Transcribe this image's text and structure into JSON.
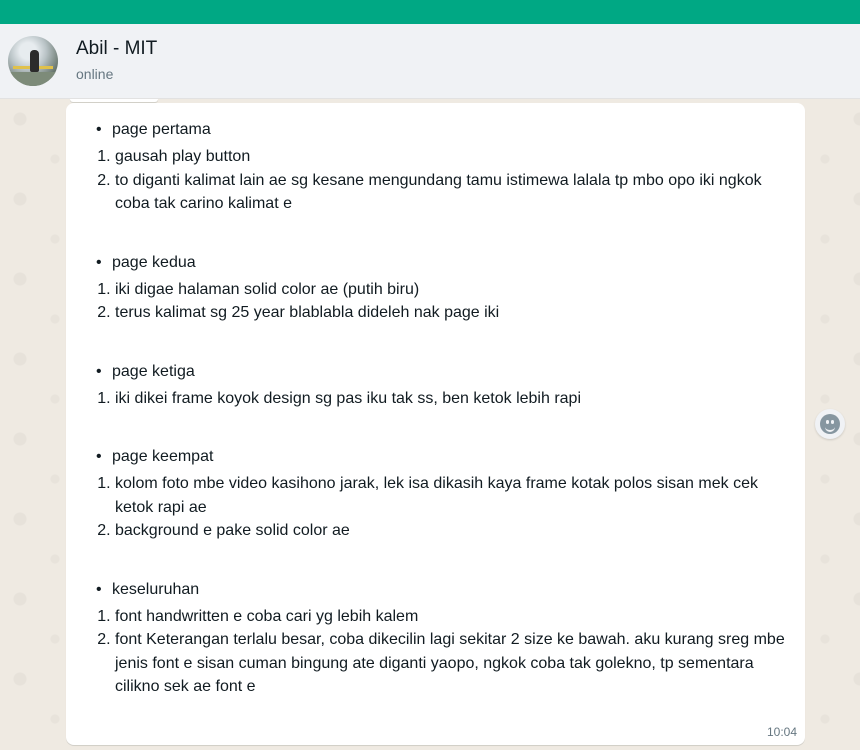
{
  "header": {
    "contact_name": "Abil - MIT",
    "status": "online"
  },
  "message": {
    "time": "10:04",
    "bullet": "•",
    "sections": [
      {
        "title": "page pertama",
        "items": [
          "gausah play button",
          "to diganti kalimat lain ae sg kesane mengundang tamu istimewa lalala tp mbo opo iki ngkok coba tak carino kalimat e"
        ]
      },
      {
        "title": "page kedua",
        "items": [
          "iki digae halaman solid color ae (putih biru)",
          "terus kalimat sg 25 year blablabla dideleh nak page iki"
        ]
      },
      {
        "title": "page ketiga",
        "items": [
          "iki dikei frame koyok design sg pas iku tak ss, ben ketok lebih rapi"
        ]
      },
      {
        "title": "page keempat",
        "items": [
          "kolom foto mbe video kasihono jarak, lek isa dikasih kaya frame kotak polos sisan mek cek ketok rapi ae",
          "background e pake solid color ae"
        ]
      },
      {
        "title": "keseluruhan",
        "items": [
          "font handwritten e coba cari yg lebih kalem",
          "font Keterangan terlalu besar, coba dikecilin lagi sekitar 2 size ke bawah. aku kurang sreg mbe jenis font e sisan cuman bingung ate diganti yaopo, ngkok coba tak golekno, tp sementara cilikno sek ae font e"
        ]
      }
    ]
  },
  "icons": {
    "reaction": "emoji-icon"
  },
  "colors": {
    "accent": "#00a884",
    "header_bg": "#f0f2f5",
    "chat_bg": "#efeae2",
    "bubble_bg": "#ffffff"
  }
}
